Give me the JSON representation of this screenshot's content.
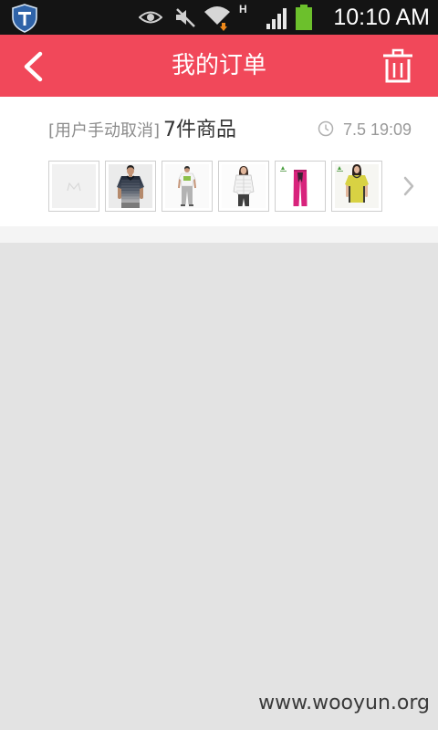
{
  "status_bar": {
    "network_type": "H",
    "time": "10:10 AM",
    "icons": [
      "shield-app-icon",
      "eye-icon",
      "muted-speaker-icon",
      "wifi-icon",
      "signal-icon",
      "battery-icon"
    ]
  },
  "header": {
    "title": "我的订单",
    "icons": [
      "back-chevron-icon",
      "trash-icon"
    ]
  },
  "order": {
    "status": "[用户手动取消]",
    "item_count": "7件商品",
    "time": "7.5 19:09",
    "icons": [
      "clock-icon",
      "chevron-right-icon"
    ]
  },
  "colors": {
    "header": "#f1485a",
    "status_bar": "#141414",
    "battery": "#6cc02c",
    "page_background": "#e3e3e3"
  },
  "watermark": "www.wooyun.org"
}
